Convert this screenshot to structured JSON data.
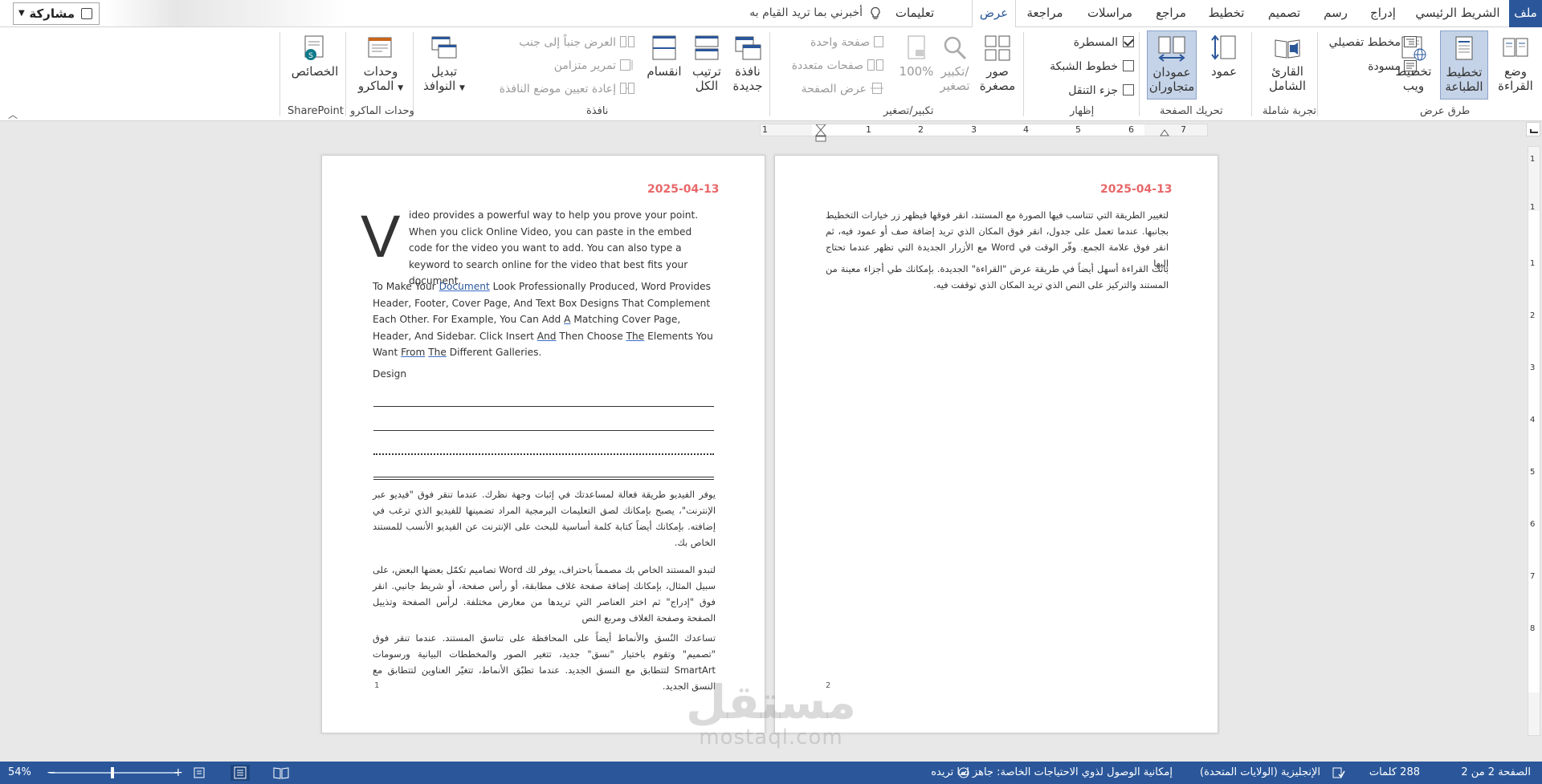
{
  "tabs": {
    "file": "ملف",
    "home": "الشريط الرئيسي",
    "insert": "إدراج",
    "draw": "رسم",
    "design": "تصميم",
    "layout": "تخطيط",
    "references": "مراجع",
    "mailings": "مراسلات",
    "review": "مراجعة",
    "view": "عرض",
    "help": "تعليمات",
    "tell_me": "أخبرني بما تريد القيام به"
  },
  "share": {
    "label": "مشاركة"
  },
  "ribbon": {
    "views": {
      "group_label": "طرق عرض",
      "read_mode": [
        "وضع",
        "القراءة"
      ],
      "print_layout": [
        "تخطيط",
        "الطباعة"
      ],
      "web_layout": [
        "تخطيط",
        "ويب"
      ],
      "outline": "مخطط تفصيلي",
      "draft": "مسودة"
    },
    "immersive": {
      "group_label": "تجربة شاملة",
      "immersive_reader": [
        "القارئ",
        "الشامل"
      ]
    },
    "page_movement": {
      "group_label": "تحريك الصفحة",
      "vertical": "عمود",
      "side_by_side": [
        "عمودان",
        "متجاوران"
      ]
    },
    "show": {
      "group_label": "إظهار",
      "ruler": "المسطرة",
      "gridlines": "خطوط الشبكة",
      "nav_pane": "جزء التنقل"
    },
    "zoom": {
      "group_label": "تكبير/تصغير",
      "thumbnails": [
        "صور",
        "مصغرة"
      ],
      "zoom": [
        "تكبير/",
        "تصغير"
      ],
      "hundred": "100%",
      "one_page": "صفحة واحدة",
      "multiple_pages": "صفحات متعددة",
      "page_width": "عرض الصفحة"
    },
    "window": {
      "group_label": "نافذة",
      "new_window": [
        "نافذة",
        "جديدة"
      ],
      "arrange_all": [
        "ترتيب",
        "الكل"
      ],
      "split": "انقسام",
      "view_side_by_side": "العرض جنباً إلى جنب",
      "sync_scroll": "تمرير متزامن",
      "reset_position": "إعادة تعيين موضع النافذة",
      "switch_windows": [
        "تبديل",
        "النوافذ"
      ]
    },
    "macros": {
      "group_label": "وحدات الماكرو",
      "macros": [
        "وحدات",
        "الماكرو"
      ]
    },
    "sharepoint": {
      "group_label": "SharePoint",
      "properties": "الخصائص"
    }
  },
  "ruler": {
    "marks": [
      "1",
      "1",
      "2",
      "3",
      "4",
      "5",
      "6",
      "7"
    ],
    "vmarks": [
      "1",
      "1",
      "1",
      "2",
      "3",
      "4",
      "5",
      "6",
      "7",
      "8"
    ]
  },
  "left_page": {
    "date": "2025-04-13",
    "drop_cap": "V",
    "intro": "ideo provides a powerful way to help you prove your point. When you click Online Video, you can paste in the embed code for the video you want to add. You can also type a keyword to search online for the video that best fits your document.",
    "para2": {
      "t1": "To Make Your ",
      "w_document": "Document",
      "t2": " Look Professionally Produced, Word Provides Header, Footer, Cover Page, And Text Box Designs That Complement Each Other. For Example, You Can Add ",
      "w_a": "A",
      "t3": " Matching Cover Page, Header, And Sidebar.  Click Insert ",
      "w_and": "And",
      "t4": " Then Choose ",
      "w_the": "The",
      "t5": " Elements You Want ",
      "w_from": "From",
      "t6": " ",
      "w_the2": "The",
      "t7": " Different Galleries."
    },
    "design": "Design",
    "ar1": "يوفر الفيديو طريقة فعالة لمساعدتك في إثبات وجهة نظرك. عندما تنقر فوق \"فيديو عبر الإنترنت\"، يصبح بإمكانك لصق التعليمات البرمجية المراد تضمينها للفيديو الذي ترغب في إضافته. بإمكانك أيضاً كتابة كلمة أساسية للبحث على الإنترنت عن الفيديو الأنسب للمستند الخاص بك.",
    "ar2": "لتبدو المستند الخاص بك مصمماً باحتراف، يوفر لك Word تصاميم تكمّل بعضها البعض، على سبيل المثال، بإمكانك إضافة صفحة غلاف مطابقة، أو رأس صفحة، أو شريط جانبي. انقر فوق \"إدراج\" ثم اختر العناصر التي تريدها من معارض مختلفة. لرأس الصفحة وتذييل الصفحة وصفحة الغلاف ومربع النص",
    "ar3": "تساعدك النُسق والأنماط أيضاً على المحافظة على تناسق المستند. عندما تنقر فوق \"تصميم\" وتقوم باختيار \"نسق\" جديد، تتغير الصور والمخططات البيانية ورسومات SmartArt لتتطابق مع النسق الجديد. عندما تطبّق الأنماط، تتغيّر العناوين لتتطابق مع النسق الجديد.",
    "page_number": "1"
  },
  "right_page": {
    "date": "2025-04-13",
    "ar1": "لتغيير الطريقة التي تتناسب فيها الصورة مع المستند، انقر فوقها فيظهر زر خيارات التخطيط بجانبها. عندما تعمل على جدول، انقر فوق المكان الذي تريد إضافة صف أو عمود فيه، ثم انقر فوق علامة الجمع. وفّر الوقت في Word مع الأزرار الجديدة التي تظهر عندما تحتاج إليها",
    "ar2": "باتت القراءة أسهل أيضاً في طريقة عرض \"القراءة\" الجديدة. بإمكانك طي أجزاء معينة من المستند والتركيز على النص الذي تريد المكان الذي توقفت فيه.",
    "page_number": "2"
  },
  "watermark": {
    "arabic": "مستقل",
    "latin": "mostaql.com"
  },
  "status": {
    "page": "الصفحة 2 من 2",
    "words": "288 كلمات",
    "language": "الإنجليزية (الولايات المتحدة)",
    "accessibility": "إمكانية الوصول لذوي الاحتياجات الخاصة: جاهز لما تريده",
    "zoom": "54%"
  },
  "colors": {
    "brand": "#2b579a",
    "date": "#e8686a"
  }
}
